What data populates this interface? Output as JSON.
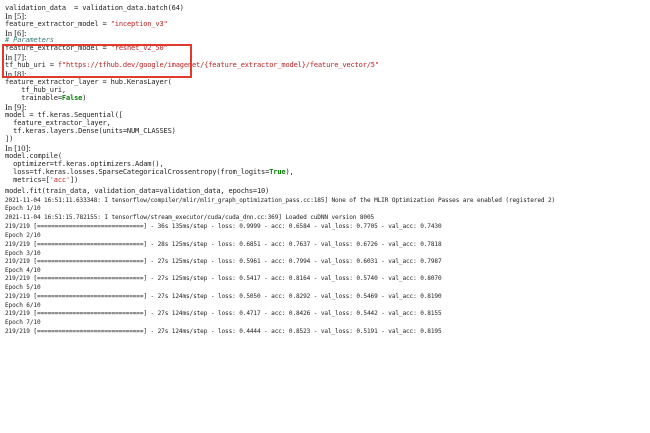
{
  "notebook": {
    "lines": [
      {
        "kind": "code",
        "segs": [
          {
            "c": "txt",
            "t": "validation_data  = validation_data.batch(64)"
          }
        ]
      },
      {
        "kind": "prompt",
        "segs": [
          {
            "c": "txt",
            "t": "In [5]:"
          }
        ]
      },
      {
        "kind": "code",
        "segs": [
          {
            "c": "txt",
            "t": "feature_extractor_model = "
          },
          {
            "c": "str",
            "t": "\"inception_v3\""
          }
        ]
      },
      {
        "kind": "prompt",
        "segs": [
          {
            "c": "txt",
            "t": "In [6]:"
          }
        ]
      },
      {
        "kind": "code",
        "segs": [
          {
            "c": "cmt",
            "t": "# Parameters"
          }
        ]
      },
      {
        "kind": "code",
        "segs": [
          {
            "c": "txt",
            "t": "feature_extractor_model = "
          },
          {
            "c": "str",
            "t": "\"resnet_v2_50\""
          }
        ]
      },
      {
        "kind": "prompt",
        "segs": [
          {
            "c": "txt",
            "t": "In [7]:"
          }
        ]
      },
      {
        "kind": "code",
        "segs": [
          {
            "c": "txt",
            "t": "tf_hub_uri = "
          },
          {
            "c": "str",
            "t": "f\"https://tfhub.dev/google/imagenet/{feature_extractor_model}/feature_vector/5\""
          }
        ]
      },
      {
        "kind": "prompt",
        "segs": [
          {
            "c": "txt",
            "t": "In [8]:"
          }
        ]
      },
      {
        "kind": "code",
        "segs": [
          {
            "c": "txt",
            "t": "feature_extractor_layer = hub.KerasLayer("
          }
        ]
      },
      {
        "kind": "code",
        "segs": [
          {
            "c": "txt",
            "t": "    tf_hub_uri,"
          }
        ]
      },
      {
        "kind": "code",
        "segs": [
          {
            "c": "txt",
            "t": "    trainable="
          },
          {
            "c": "kw",
            "t": "False"
          },
          {
            "c": "txt",
            "t": ")"
          }
        ]
      },
      {
        "kind": "prompt",
        "segs": [
          {
            "c": "txt",
            "t": "In [9]:"
          }
        ]
      },
      {
        "kind": "code",
        "segs": [
          {
            "c": "txt",
            "t": "model = tf.keras.Sequential(["
          }
        ]
      },
      {
        "kind": "code",
        "segs": [
          {
            "c": "txt",
            "t": "  feature_extractor_layer,"
          }
        ]
      },
      {
        "kind": "code",
        "segs": [
          {
            "c": "txt",
            "t": "  tf.keras.layers.Dense(units=NUM_CLASSES)"
          }
        ]
      },
      {
        "kind": "code",
        "segs": [
          {
            "c": "txt",
            "t": "])"
          }
        ]
      },
      {
        "kind": "prompt",
        "segs": [
          {
            "c": "txt",
            "t": "In [10]:"
          }
        ]
      },
      {
        "kind": "code",
        "segs": [
          {
            "c": "txt",
            "t": "model.compile("
          }
        ]
      },
      {
        "kind": "code",
        "segs": [
          {
            "c": "txt",
            "t": "  optimizer=tf.keras.optimizers.Adam(),"
          }
        ]
      },
      {
        "kind": "code",
        "segs": [
          {
            "c": "txt",
            "t": "  loss=tf.keras.losses.SparseCategoricalCrossentropy(from_logits="
          },
          {
            "c": "kw",
            "t": "True"
          },
          {
            "c": "txt",
            "t": "),"
          }
        ]
      },
      {
        "kind": "code",
        "segs": [
          {
            "c": "txt",
            "t": "  metrics=["
          },
          {
            "c": "str",
            "t": "'acc'"
          },
          {
            "c": "txt",
            "t": "])"
          }
        ]
      },
      {
        "kind": "code",
        "segs": [
          {
            "c": "txt",
            "t": "model.fit(train_data, validation_data=validation_data, epochs=10)"
          }
        ]
      },
      {
        "kind": "out",
        "segs": [
          {
            "c": "txt",
            "t": "2021-11-04 16:51:11.633348: I tensorflow/compiler/mlir/mlir_graph_optimization_pass.cc:185] None of the MLIR Optimization Passes are enabled (registered 2)"
          }
        ]
      },
      {
        "kind": "out",
        "segs": [
          {
            "c": "txt",
            "t": "Epoch 1/10"
          }
        ]
      },
      {
        "kind": "out",
        "segs": [
          {
            "c": "txt",
            "t": "2021-11-04 16:51:15.782155: I tensorflow/stream_executor/cuda/cuda_dnn.cc:369] Loaded cuDNN version 8005"
          }
        ]
      },
      {
        "kind": "out",
        "segs": [
          {
            "c": "txt",
            "t": "219/219 [==============================] - 36s 135ms/step - loss: 0.9999 - acc: 0.6584 - val_loss: 0.7705 - val_acc: 0.7430"
          }
        ]
      },
      {
        "kind": "out",
        "segs": [
          {
            "c": "txt",
            "t": "Epoch 2/10"
          }
        ]
      },
      {
        "kind": "out",
        "segs": [
          {
            "c": "txt",
            "t": "219/219 [==============================] - 28s 125ms/step - loss: 0.6851 - acc: 0.7637 - val_loss: 0.6726 - val_acc: 0.7818"
          }
        ]
      },
      {
        "kind": "out",
        "segs": [
          {
            "c": "txt",
            "t": "Epoch 3/10"
          }
        ]
      },
      {
        "kind": "out",
        "segs": [
          {
            "c": "txt",
            "t": "219/219 [==============================] - 27s 125ms/step - loss: 0.5961 - acc: 0.7994 - val_loss: 0.6031 - val_acc: 0.7987"
          }
        ]
      },
      {
        "kind": "out",
        "segs": [
          {
            "c": "txt",
            "t": "Epoch 4/10"
          }
        ]
      },
      {
        "kind": "out",
        "segs": [
          {
            "c": "txt",
            "t": "219/219 [==============================] - 27s 125ms/step - loss: 0.5417 - acc: 0.8164 - val_loss: 0.5740 - val_acc: 0.8070"
          }
        ]
      },
      {
        "kind": "out",
        "segs": [
          {
            "c": "txt",
            "t": "Epoch 5/10"
          }
        ]
      },
      {
        "kind": "out",
        "segs": [
          {
            "c": "txt",
            "t": "219/219 [==============================] - 27s 124ms/step - loss: 0.5050 - acc: 0.8292 - val_loss: 0.5469 - val_acc: 0.8190"
          }
        ]
      },
      {
        "kind": "out",
        "segs": [
          {
            "c": "txt",
            "t": "Epoch 6/10"
          }
        ]
      },
      {
        "kind": "out",
        "segs": [
          {
            "c": "txt",
            "t": "219/219 [==============================] - 27s 124ms/step - loss: 0.4717 - acc: 0.8426 - val_loss: 0.5442 - val_acc: 0.8155"
          }
        ]
      },
      {
        "kind": "out",
        "segs": [
          {
            "c": "txt",
            "t": "Epoch 7/10"
          }
        ]
      },
      {
        "kind": "out",
        "segs": [
          {
            "c": "txt",
            "t": "219/219 [==============================] - 27s 124ms/step - loss: 0.4444 - acc: 0.8523 - val_loss: 0.5191 - val_acc: 0.8195"
          }
        ]
      }
    ]
  },
  "colors": {
    "highlight": "#e23b2e",
    "string": "#ba2121",
    "keyword": "#008000",
    "comment": "#408080"
  }
}
